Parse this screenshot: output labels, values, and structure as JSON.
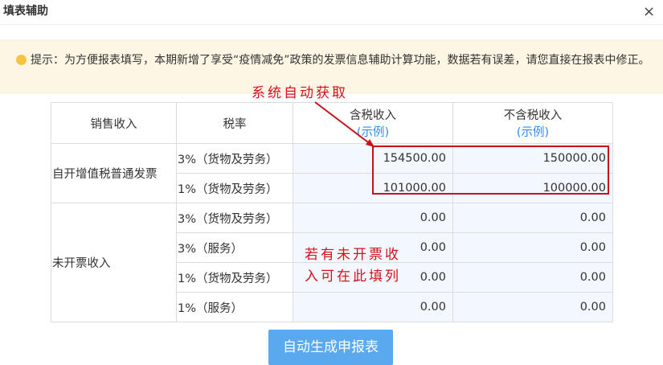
{
  "dialog": {
    "title": "填表辅助",
    "close": "×"
  },
  "notice": {
    "icon": "warning-dot-icon",
    "text": "提示：为方便报表填写，本期新增了享受“疫情减免”政策的发票信息辅助计算功能，数据若有误差，请您直接在报表中修正。"
  },
  "table": {
    "headers": {
      "sales": "销售收入",
      "rate": "税率",
      "tax_incl": "含税收入",
      "tax_excl": "不含税收入",
      "example": "(示例)"
    },
    "groups": [
      {
        "label": "自开增值税普通发票",
        "rows": [
          {
            "rate": "3%（货物及劳务）",
            "tax_incl": "154500.00",
            "tax_excl": "150000.00"
          },
          {
            "rate": "1%（货物及劳务）",
            "tax_incl": "101000.00",
            "tax_excl": "100000.00"
          }
        ]
      },
      {
        "label": "未开票收入",
        "rows": [
          {
            "rate": "3%（货物及劳务）",
            "tax_incl": "0.00",
            "tax_excl": "0.00"
          },
          {
            "rate": "3%（服务）",
            "tax_incl": "0.00",
            "tax_excl": "0.00"
          },
          {
            "rate": "1%（货物及劳务）",
            "tax_incl": "0.00",
            "tax_excl": "0.00"
          },
          {
            "rate": "1%（服务）",
            "tax_incl": "0.00",
            "tax_excl": "0.00"
          }
        ]
      }
    ]
  },
  "annotations": {
    "auto_fetch": "系统自动获取",
    "fill_hint_line1": "若有未开票收",
    "fill_hint_line2": "入可在此填列"
  },
  "button": {
    "label": "自动生成申报表"
  },
  "colors": {
    "accent": "#2d8cf0",
    "button": "#5aa9ef",
    "annotation": "#d6101c",
    "notice_bg": "#fdf6e4"
  }
}
